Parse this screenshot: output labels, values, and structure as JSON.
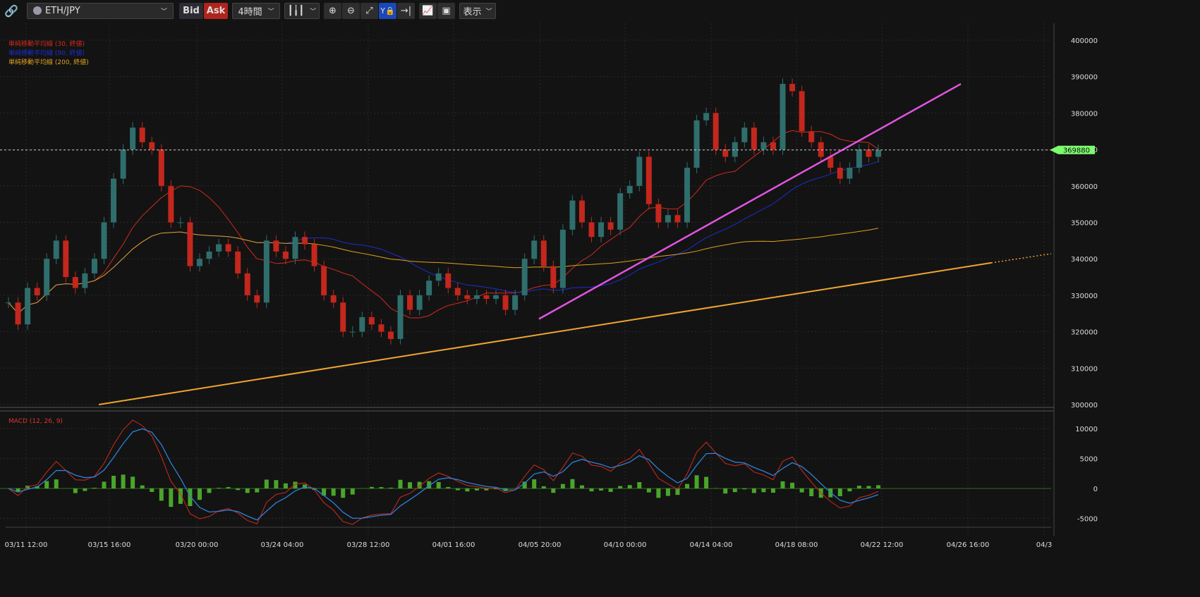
{
  "toolbar": {
    "symbol": "ETH/JPY",
    "bid": "Bid",
    "ask": "Ask",
    "interval": "4時間",
    "view": "表示",
    "icons": [
      "link-icon",
      "candlestick-icon",
      "zoom-in-icon",
      "zoom-out-icon",
      "fit-icon",
      "y-lock-icon",
      "scroll-to-end-icon",
      "add-indicator-icon",
      "drawing-icon"
    ]
  },
  "legend": [
    {
      "label": "単純移動平均線 (30, 終値)",
      "color": "#d22a1e"
    },
    {
      "label": "単純移動平均線 (90, 終値)",
      "color": "#1a2fd0"
    },
    {
      "label": "単純移動平均線 (200, 終値)",
      "color": "#e0a020"
    }
  ],
  "macd_label": "MACD (12, 26, 9)",
  "colors": {
    "up": "#2f6e6c",
    "down": "#c3271d",
    "price_tag": "#7dfa6e",
    "trend_magenta": "#e055e0",
    "trend_orange": "#f0a530",
    "histogram": "#4aa52a",
    "macd": "#d22a1e",
    "signal": "#2f7fd8"
  },
  "chart_data": [
    {
      "type": "candlestick",
      "symbol": "ETH/JPY",
      "current_price": 369880,
      "ylim": [
        300000,
        400000
      ],
      "yticks": [
        300000,
        310000,
        320000,
        330000,
        340000,
        350000,
        360000,
        370000,
        380000,
        390000,
        400000
      ],
      "xticks": [
        "03/11 12:00",
        "03/15 16:00",
        "03/20 00:00",
        "03/24 04:00",
        "03/28 12:00",
        "04/01 16:00",
        "04/05 20:00",
        "04/10 00:00",
        "04/14 04:00",
        "04/18 08:00",
        "04/22 12:00",
        "04/26 16:00",
        "04/3"
      ],
      "closes": [
        328000,
        322000,
        332000,
        330000,
        340000,
        345000,
        335000,
        332000,
        336000,
        340000,
        350000,
        362000,
        370000,
        376000,
        372000,
        370000,
        360000,
        350000,
        350000,
        338000,
        340000,
        342000,
        344000,
        342000,
        336000,
        330000,
        328000,
        345000,
        342000,
        340000,
        346000,
        344000,
        338000,
        330000,
        328000,
        320000,
        320000,
        324000,
        322000,
        320000,
        318000,
        330000,
        326000,
        330000,
        334000,
        336000,
        332000,
        330000,
        329000,
        330000,
        329000,
        330000,
        326000,
        330000,
        340000,
        345000,
        338000,
        332000,
        348000,
        356000,
        350000,
        346000,
        350000,
        348000,
        358000,
        360000,
        368000,
        355000,
        350000,
        352000,
        350000,
        365000,
        378000,
        380000,
        370000,
        368000,
        372000,
        376000,
        370000,
        372000,
        370000,
        388000,
        386000,
        375000,
        372000,
        368000,
        365000,
        362000,
        365000,
        370000,
        368000,
        369880
      ],
      "indicators": [
        "SMA 30",
        "SMA 90",
        "SMA 200"
      ],
      "trendlines": [
        {
          "color": "magenta",
          "from": [
            "04/05 20:00",
            323500
          ],
          "to": [
            "04/24",
            388000
          ]
        },
        {
          "color": "orange",
          "from": [
            "03/14",
            300000
          ],
          "to": [
            "04/27",
            339000
          ],
          "extension": "dotted"
        }
      ]
    },
    {
      "type": "macd",
      "params": [
        12,
        26,
        9
      ],
      "ylim": [
        -7000,
        12000
      ],
      "yticks": [
        -5000,
        0,
        5000,
        10000
      ]
    }
  ]
}
